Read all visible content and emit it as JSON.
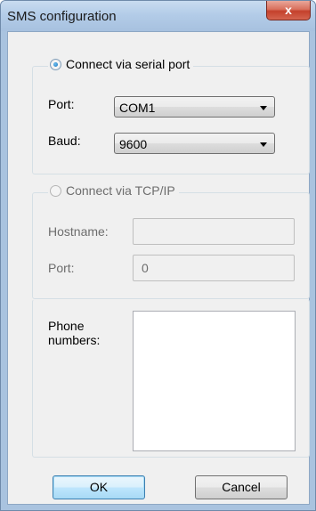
{
  "window": {
    "title": "SMS configuration",
    "close_label": "x"
  },
  "serial": {
    "label": "Connect via serial port",
    "selected": true,
    "port_label": "Port:",
    "port_value": "COM1",
    "baud_label": "Baud:",
    "baud_value": "9600"
  },
  "tcp": {
    "label": "Connect via TCP/IP",
    "selected": false,
    "hostname_label": "Hostname:",
    "hostname_value": "",
    "port_label": "Port:",
    "port_value": "0"
  },
  "phone": {
    "label": "Phone numbers:",
    "value": ""
  },
  "buttons": {
    "ok": "OK",
    "cancel": "Cancel"
  }
}
